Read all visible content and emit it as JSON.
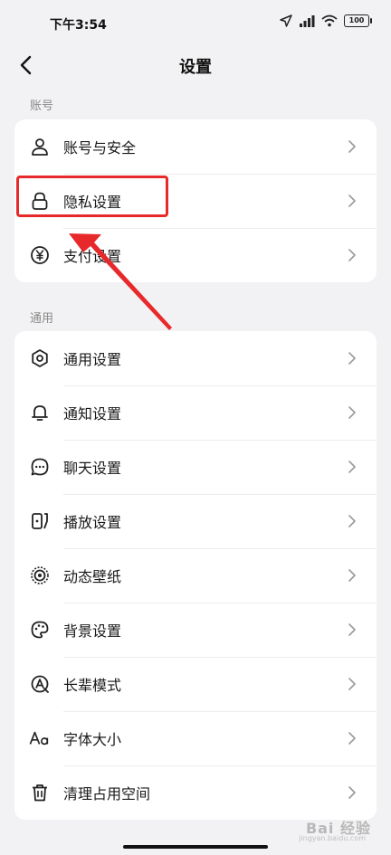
{
  "status_bar": {
    "time": "下午3:54",
    "battery": "100"
  },
  "header": {
    "title": "设置"
  },
  "sections": [
    {
      "label": "账号",
      "items": [
        {
          "label": "账号与安全",
          "icon": "user-icon"
        },
        {
          "label": "隐私设置",
          "icon": "lock-icon"
        },
        {
          "label": "支付设置",
          "icon": "yuan-icon"
        }
      ]
    },
    {
      "label": "通用",
      "items": [
        {
          "label": "通用设置",
          "icon": "gear-icon"
        },
        {
          "label": "通知设置",
          "icon": "bell-icon"
        },
        {
          "label": "聊天设置",
          "icon": "chat-icon"
        },
        {
          "label": "播放设置",
          "icon": "play-icon"
        },
        {
          "label": "动态壁纸",
          "icon": "live-wallpaper-icon"
        },
        {
          "label": "背景设置",
          "icon": "palette-icon"
        },
        {
          "label": "长辈模式",
          "icon": "elder-mode-icon"
        },
        {
          "label": "字体大小",
          "icon": "font-size-icon"
        },
        {
          "label": "清理占用空间",
          "icon": "trash-icon"
        }
      ]
    }
  ],
  "watermark": {
    "text": "Bai 经验",
    "sub": "jingyan.baidu.com"
  },
  "colors": {
    "highlight": "#e8292b",
    "background": "#f2f2f4"
  }
}
